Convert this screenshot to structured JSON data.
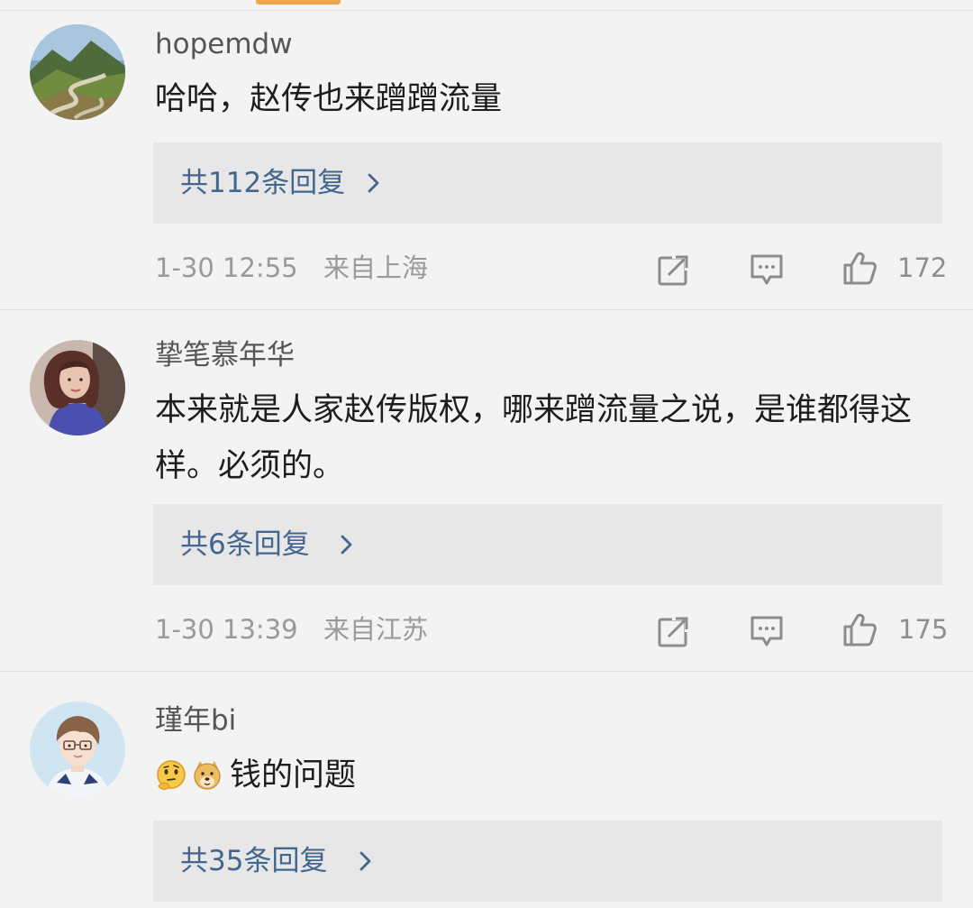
{
  "comments": [
    {
      "username": "hopemdw",
      "text": "哈哈，赵传也来蹭蹭流量",
      "reply_label": "共112条回复",
      "timestamp": "1-30 12:55",
      "location": "来自上海",
      "likes": "172",
      "avatar_icon": "mountain-road-avatar-icon"
    },
    {
      "username": "挚笔慕年华",
      "text": "本来就是人家赵传版权，哪来蹭流量之说，是谁都得这样。必须的。",
      "reply_label": "共6条回复",
      "timestamp": "1-30 13:39",
      "location": "来自江苏",
      "likes": "175",
      "avatar_icon": "portrait-avatar-icon"
    },
    {
      "username": "瑾年bi",
      "emojis": [
        "thinking-face-icon",
        "doge-icon"
      ],
      "text": "钱的问题",
      "reply_label": "共35条回复",
      "avatar_icon": "cartoon-boy-avatar-icon"
    }
  ],
  "icons": {
    "share": "share-icon",
    "comment": "comment-icon",
    "like": "like-icon",
    "chevron": "chevron-right-icon"
  },
  "colors": {
    "page_background": "#f3f3f3",
    "reply_box_background": "#e7e7e7",
    "reply_link": "#43668f",
    "meta_text": "#9a9a9a",
    "accent": "#f0a64b"
  }
}
